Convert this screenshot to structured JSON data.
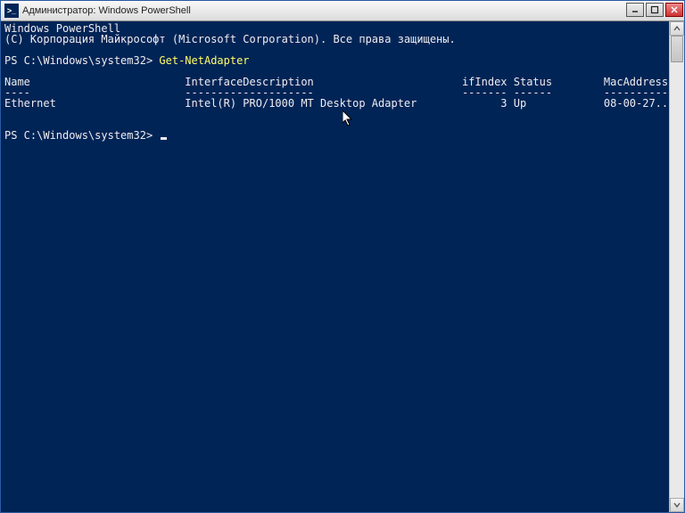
{
  "window": {
    "title": "Администратор: Windows PowerShell"
  },
  "terminal": {
    "banner1": "Windows PowerShell",
    "banner2": "(C) Корпорация Майкрософт (Microsoft Corporation). Все права защищены.",
    "prompt1_prefix": "PS C:\\Windows\\system32> ",
    "command1": "Get-NetAdapter",
    "headers": {
      "name": "Name",
      "desc": "InterfaceDescription",
      "ifindex": "ifIndex",
      "status": "Status",
      "mac": "MacAddress"
    },
    "underline": {
      "name": "----",
      "desc": "--------------------",
      "ifindex": "-------",
      "status": "------",
      "mac": "----------"
    },
    "row": {
      "name": "Ethernet",
      "desc": "Intel(R) PRO/1000 MT Desktop Adapter",
      "ifindex": "3",
      "status": "Up",
      "mac": "08-00-27..."
    },
    "prompt2": "PS C:\\Windows\\system32> "
  }
}
